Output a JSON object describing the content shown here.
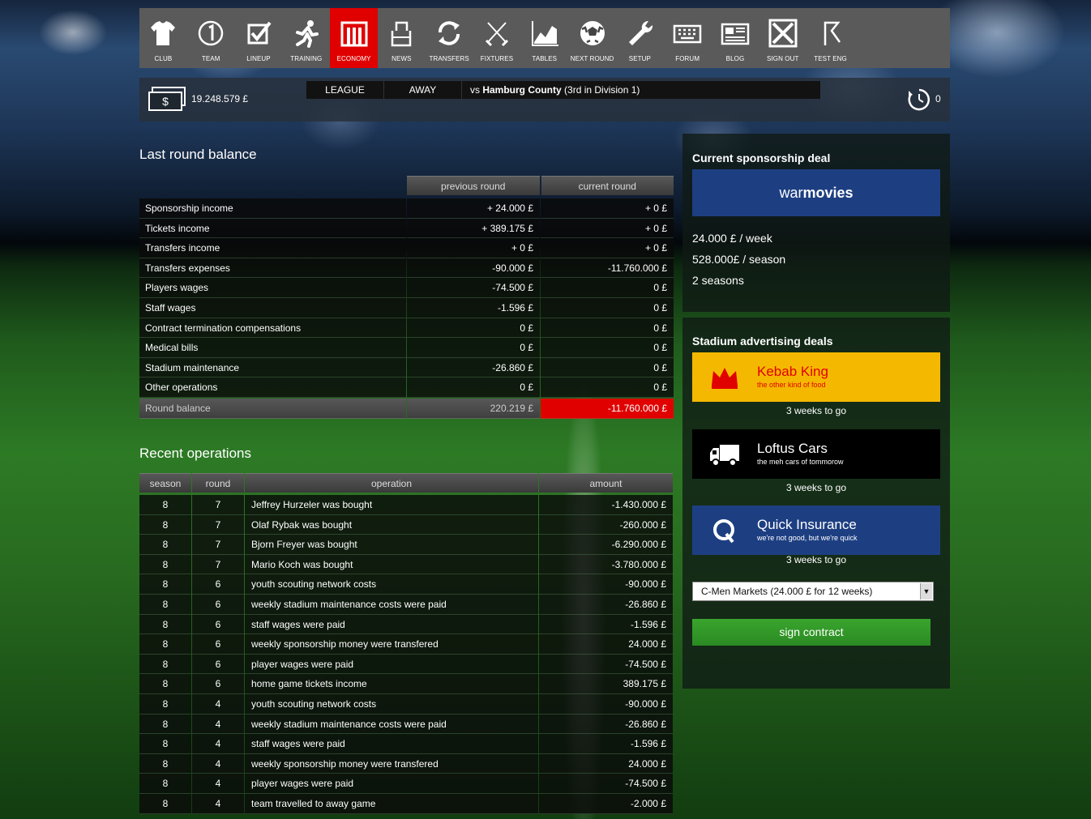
{
  "nav": {
    "items": [
      {
        "label": "CLUB",
        "icon": "shirt-icon"
      },
      {
        "label": "TEAM",
        "icon": "number-one-icon"
      },
      {
        "label": "LINEUP",
        "icon": "checkbox-icon"
      },
      {
        "label": "TRAINING",
        "icon": "runner-icon"
      },
      {
        "label": "ECONOMY",
        "icon": "economy-icon"
      },
      {
        "label": "NEWS",
        "icon": "news-icon"
      },
      {
        "label": "TRANSFERS",
        "icon": "refresh-icon"
      },
      {
        "label": "FIXTURES",
        "icon": "swords-icon"
      },
      {
        "label": "TABLES",
        "icon": "chart-icon"
      },
      {
        "label": "NEXT ROUND",
        "icon": "ball-icon"
      },
      {
        "label": "SETUP",
        "icon": "wrench-icon"
      },
      {
        "label": "FORUM",
        "icon": "keyboard-icon"
      },
      {
        "label": "BLOG",
        "icon": "blog-icon"
      },
      {
        "label": "SIGN OUT",
        "icon": "close-icon"
      },
      {
        "label": "TEST ENG",
        "icon": "flag-icon"
      }
    ],
    "active": "ECONOMY",
    "active_color": "#e00000"
  },
  "info": {
    "money": "19.248.579 £",
    "competition": "LEAGUE",
    "venue": "AWAY",
    "vs_prefix": "vs",
    "opponent": "Hamburg County",
    "opponent_detail": "(3rd in Division 1)",
    "timer": "0"
  },
  "balance": {
    "title": "Last round balance",
    "col_previous": "previous round",
    "col_current": "current round",
    "rows": [
      {
        "label": "Sponsorship income",
        "previous": "+ 24.000 £",
        "current": "+ 0 £"
      },
      {
        "label": "Tickets income",
        "previous": "+ 389.175 £",
        "current": "+ 0 £"
      },
      {
        "label": "Transfers income",
        "previous": "+ 0 £",
        "current": "+ 0 £"
      },
      {
        "label": "Transfers expenses",
        "previous": "-90.000 £",
        "current": "-11.760.000 £"
      },
      {
        "label": "Players wages",
        "previous": "-74.500 £",
        "current": "0 £"
      },
      {
        "label": "Staff wages",
        "previous": "-1.596 £",
        "current": "0 £"
      },
      {
        "label": "Contract termination compensations",
        "previous": "0 £",
        "current": "0 £"
      },
      {
        "label": "Medical bills",
        "previous": "0 £",
        "current": "0 £"
      },
      {
        "label": "Stadium maintenance",
        "previous": "-26.860 £",
        "current": "0 £"
      },
      {
        "label": "Other operations",
        "previous": "0 £",
        "current": "0 £"
      }
    ],
    "total": {
      "label": "Round balance",
      "previous": "220.219 £",
      "current": "-11.760.000 £"
    },
    "negative_color": "#e00000"
  },
  "operations": {
    "title": "Recent operations",
    "headers": {
      "season": "season",
      "round": "round",
      "operation": "operation",
      "amount": "amount"
    },
    "rows": [
      {
        "season": "8",
        "round": "7",
        "operation": "Jeffrey Hurzeler was bought",
        "amount": "-1.430.000 £"
      },
      {
        "season": "8",
        "round": "7",
        "operation": "Olaf Rybak was bought",
        "amount": "-260.000 £"
      },
      {
        "season": "8",
        "round": "7",
        "operation": "Bjorn Freyer was bought",
        "amount": "-6.290.000 £"
      },
      {
        "season": "8",
        "round": "7",
        "operation": "Mario Koch was bought",
        "amount": "-3.780.000 £"
      },
      {
        "season": "8",
        "round": "6",
        "operation": "youth scouting network costs",
        "amount": "-90.000 £"
      },
      {
        "season": "8",
        "round": "6",
        "operation": "weekly stadium maintenance costs were paid",
        "amount": "-26.860 £"
      },
      {
        "season": "8",
        "round": "6",
        "operation": "staff wages were paid",
        "amount": "-1.596 £"
      },
      {
        "season": "8",
        "round": "6",
        "operation": "weekly sponsorship money were transfered",
        "amount": "24.000 £"
      },
      {
        "season": "8",
        "round": "6",
        "operation": "player wages were paid",
        "amount": "-74.500 £"
      },
      {
        "season": "8",
        "round": "6",
        "operation": "home game tickets income",
        "amount": "389.175 £"
      },
      {
        "season": "8",
        "round": "4",
        "operation": "youth scouting network costs",
        "amount": "-90.000 £"
      },
      {
        "season": "8",
        "round": "4",
        "operation": "weekly stadium maintenance costs were paid",
        "amount": "-26.860 £"
      },
      {
        "season": "8",
        "round": "4",
        "operation": "staff wages were paid",
        "amount": "-1.596 £"
      },
      {
        "season": "8",
        "round": "4",
        "operation": "weekly sponsorship money were transfered",
        "amount": "24.000 £"
      },
      {
        "season": "8",
        "round": "4",
        "operation": "player wages were paid",
        "amount": "-74.500 £"
      },
      {
        "season": "8",
        "round": "4",
        "operation": "team travelled to away game",
        "amount": "-2.000 £"
      }
    ]
  },
  "sponsorship": {
    "title": "Current sponsorship deal",
    "sponsor_prefix": "war",
    "sponsor_suffix": "movies",
    "sponsor_color": "#1d3f82",
    "per_week": "24.000 £ / week",
    "per_season": "528.000£ / season",
    "seasons": "2 seasons"
  },
  "advertising": {
    "title": "Stadium advertising deals",
    "deals": [
      {
        "name": "Kebab King",
        "tagline": "the other kind of food",
        "weeks": "3 weeks to go",
        "bg": "#f5b800",
        "text_color": "#e00000",
        "icon": "crown-icon"
      },
      {
        "name": "Loftus Cars",
        "tagline": "the meh cars of tommorow",
        "weeks": "3 weeks to go",
        "bg": "#000000",
        "text_color": "#ffffff",
        "icon": "truck-icon"
      },
      {
        "name": "Quick Insurance",
        "tagline": "we're not good, but we're quick",
        "weeks": "3 weeks to go",
        "bg": "#1d3f82",
        "text_color": "#ffffff",
        "icon": "q-letter-icon"
      }
    ],
    "select_value": "C-Men Markets (24.000 £ for 12 weeks)",
    "sign_button": "sign contract",
    "button_color": "#3aa52e"
  }
}
